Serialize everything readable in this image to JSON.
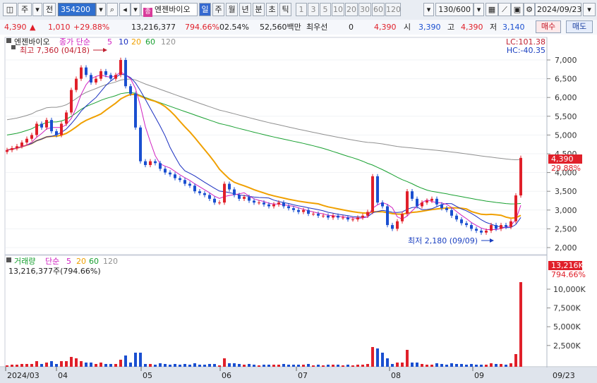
{
  "toolbar": {
    "market_label": "주",
    "prefix_label": "전",
    "stock_code": "354200",
    "stock_name": "엔젠바이오",
    "name_badge": "종",
    "periods": [
      "일",
      "주",
      "월",
      "년",
      "분",
      "초",
      "틱"
    ],
    "active_period": "일",
    "intervals": [
      "1",
      "3",
      "5",
      "10",
      "20",
      "30",
      "60",
      "120"
    ],
    "count_value": "130/600",
    "date_value": "2024/09/23"
  },
  "infobar": {
    "price": "4,390",
    "change": "1,010",
    "change_pct": "+29.88%",
    "volume": "13,216,377",
    "volume_ratio": "794.66%",
    "turnover": "02.54%",
    "amount": "52,560백만",
    "preferred_label": "최우선",
    "preferred_value": "0",
    "ask": "4,390",
    "open_label": "시",
    "open": "3,390",
    "high_label": "고",
    "high": "4,390",
    "low_label": "저",
    "low": "3,140",
    "buy_button": "매수",
    "sell_button": "매도"
  },
  "price_panel": {
    "name": "엔젠바이오",
    "legend_prefix": "종가 단순",
    "ma_periods": [
      "5",
      "10",
      "20",
      "60",
      "120"
    ],
    "ma_colors": [
      "#d020c0",
      "#1a2fc0",
      "#f0a000",
      "#18a030",
      "#909090"
    ],
    "lc_text": "LC:101.38",
    "hc_text": "HC:-40.35",
    "max_label": "최고 7,360 (04/18)",
    "min_label": "최저 2,180 (09/09)",
    "current_price_tag": "4,390",
    "current_pct_tag": "29.88%",
    "y_ticks": [
      "7,000",
      "6,500",
      "6,000",
      "5,500",
      "5,000",
      "4,500",
      "4,000",
      "3,500",
      "3,000",
      "2,500",
      "2,000"
    ]
  },
  "volume_panel": {
    "title": "거래량",
    "legend_prefix": "단순",
    "ma_periods": [
      "5",
      "20",
      "60",
      "120"
    ],
    "value_text": "13,216,377주(794.66%)",
    "current_tag": "13,216K",
    "current_pct_tag": "794.66%",
    "y_ticks": [
      "10,000K",
      "7,500K",
      "5,000K",
      "2,500K"
    ]
  },
  "x_axis": {
    "labels": [
      "2024/03",
      "04",
      "05",
      "06",
      "07",
      "08",
      "09"
    ],
    "right_label": "09/23"
  },
  "colors": {
    "up": "#e0202a",
    "down": "#1a4fd0",
    "background": "#ffffff",
    "accent": "#3468d0"
  }
}
